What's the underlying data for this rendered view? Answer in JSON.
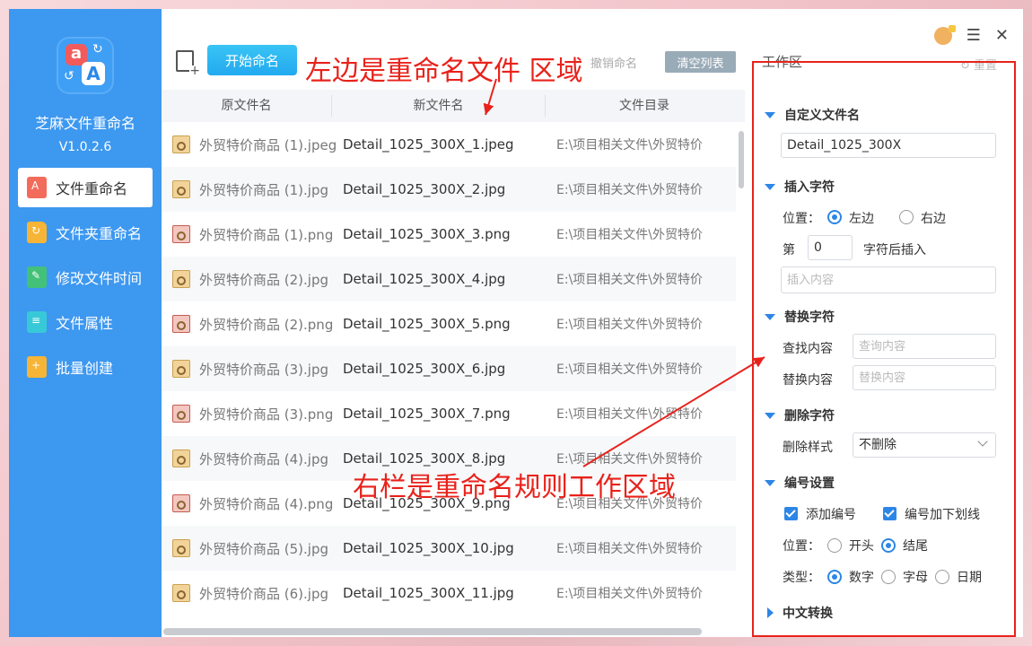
{
  "sidebar": {
    "app_name": "芝麻文件重命名",
    "version": "V1.0.2.6",
    "items": [
      {
        "label": "文件重命名",
        "icon": "file-rename-icon",
        "active": true
      },
      {
        "label": "文件夹重命名",
        "icon": "folder-rename-icon"
      },
      {
        "label": "修改文件时间",
        "icon": "file-time-icon"
      },
      {
        "label": "文件属性",
        "icon": "file-attribute-icon"
      },
      {
        "label": "批量创建",
        "icon": "batch-create-icon"
      }
    ]
  },
  "toolbar": {
    "start_label": "开始命名",
    "undo_label": "撤销命名",
    "clear_label": "清空列表",
    "workspace_title": "工作区",
    "reset_label": "重置"
  },
  "annotations": {
    "left": "左边是重命名文件 区域",
    "right": "右栏是重命名规则工作区域"
  },
  "table": {
    "headers": [
      "原文件名",
      "新文件名",
      "文件目录"
    ],
    "rows": [
      {
        "orig": "外贸特价商品 (1).jpeg",
        "new": "Detail_1025_300X_1.jpeg",
        "dir": "E:\\项目相关文件\\外贸特价",
        "type": "jpg"
      },
      {
        "orig": "外贸特价商品 (1).jpg",
        "new": "Detail_1025_300X_2.jpg",
        "dir": "E:\\项目相关文件\\外贸特价",
        "type": "jpg"
      },
      {
        "orig": "外贸特价商品 (1).png",
        "new": "Detail_1025_300X_3.png",
        "dir": "E:\\项目相关文件\\外贸特价",
        "type": "png"
      },
      {
        "orig": "外贸特价商品 (2).jpg",
        "new": "Detail_1025_300X_4.jpg",
        "dir": "E:\\项目相关文件\\外贸特价",
        "type": "jpg"
      },
      {
        "orig": "外贸特价商品 (2).png",
        "new": "Detail_1025_300X_5.png",
        "dir": "E:\\项目相关文件\\外贸特价",
        "type": "png"
      },
      {
        "orig": "外贸特价商品 (3).jpg",
        "new": "Detail_1025_300X_6.jpg",
        "dir": "E:\\项目相关文件\\外贸特价",
        "type": "jpg"
      },
      {
        "orig": "外贸特价商品 (3).png",
        "new": "Detail_1025_300X_7.png",
        "dir": "E:\\项目相关文件\\外贸特价",
        "type": "png"
      },
      {
        "orig": "外贸特价商品 (4).jpg",
        "new": "Detail_1025_300X_8.jpg",
        "dir": "E:\\项目相关文件\\外贸特价",
        "type": "jpg"
      },
      {
        "orig": "外贸特价商品 (4).png",
        "new": "Detail_1025_300X_9.png",
        "dir": "E:\\项目相关文件\\外贸特价",
        "type": "png"
      },
      {
        "orig": "外贸特价商品 (5).jpg",
        "new": "Detail_1025_300X_10.jpg",
        "dir": "E:\\项目相关文件\\外贸特价",
        "type": "jpg"
      },
      {
        "orig": "外贸特价商品 (6).jpg",
        "new": "Detail_1025_300X_11.jpg",
        "dir": "E:\\项目相关文件\\外贸特价",
        "type": "jpg"
      }
    ]
  },
  "panel": {
    "custom_name": {
      "title": "自定义文件名",
      "value": "Detail_1025_300X"
    },
    "insert": {
      "title": "插入字符",
      "position_label": "位置：",
      "left": "左边",
      "right": "右边",
      "nth_prefix": "第",
      "nth_value": "0",
      "nth_suffix": "字符后插入",
      "content_placeholder": "插入内容"
    },
    "replace": {
      "title": "替换字符",
      "find_label": "查找内容",
      "find_placeholder": "查询内容",
      "replace_label": "替换内容",
      "replace_placeholder": "替换内容"
    },
    "delete": {
      "title": "删除字符",
      "style_label": "删除样式",
      "style_value": "不删除"
    },
    "numbering": {
      "title": "编号设置",
      "add_number": "添加编号",
      "underline": "编号加下划线",
      "position_label": "位置：",
      "start": "开头",
      "end": "结尾",
      "type_label": "类型：",
      "digit": "数字",
      "letter": "字母",
      "date": "日期"
    },
    "chinese": {
      "title": "中文转换"
    }
  }
}
